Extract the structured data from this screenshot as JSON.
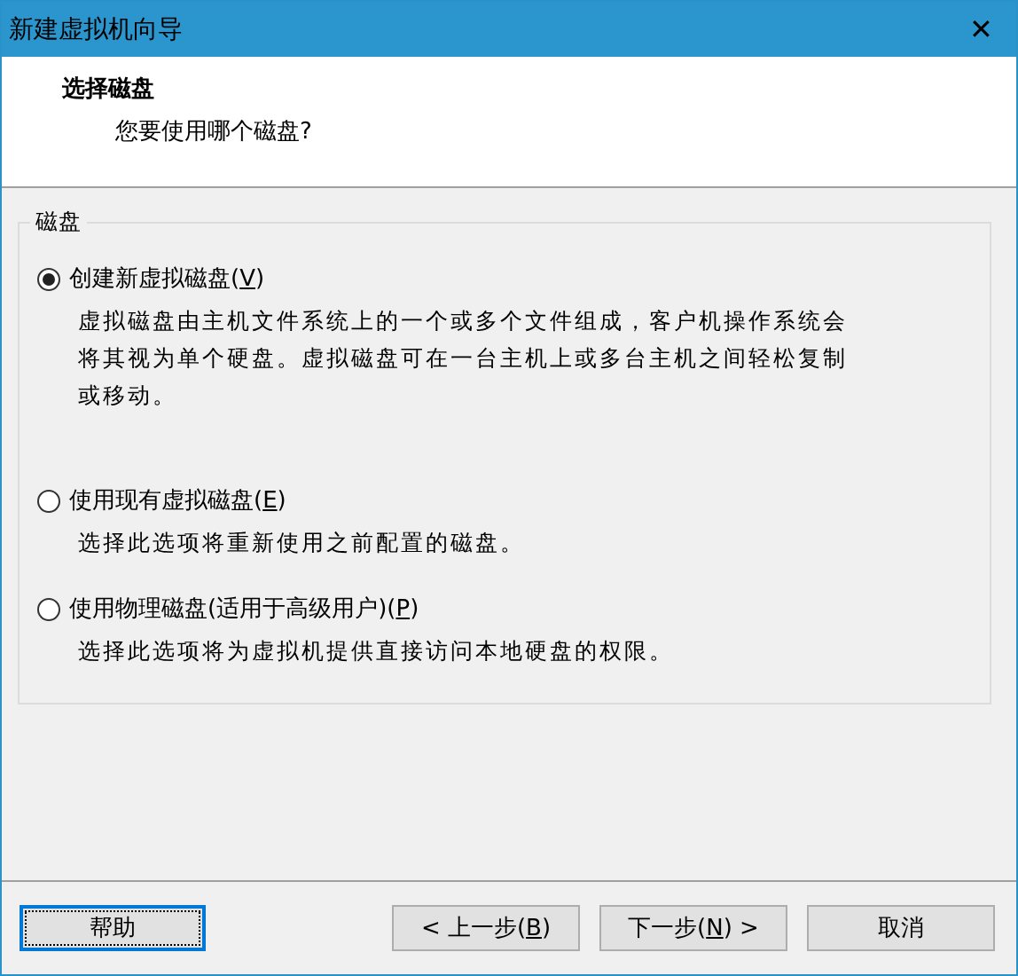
{
  "window": {
    "title": "新建虚拟机向导",
    "close": "✕"
  },
  "header": {
    "title": "选择磁盘",
    "subtitle": "您要使用哪个磁盘?"
  },
  "group": {
    "title": "磁盘",
    "options": [
      {
        "before": "创建新虚拟磁盘(",
        "key": "V",
        "after": ")",
        "description": "虚拟磁盘由主机文件系统上的一个或多个文件组成，客户机操作系统会将其视为单个硬盘。虚拟磁盘可在一台主机上或多台主机之间轻松复制或移动。",
        "selected": true
      },
      {
        "before": "使用现有虚拟磁盘(",
        "key": "E",
        "after": ")",
        "description": "选择此选项将重新使用之前配置的磁盘。",
        "selected": false
      },
      {
        "before": "使用物理磁盘(适用于高级用户)(",
        "key": "P",
        "after": ")",
        "description": "选择此选项将为虚拟机提供直接访问本地硬盘的权限。",
        "selected": false
      }
    ]
  },
  "buttons": [
    {
      "kind": "help",
      "before": "帮助",
      "focused": true
    },
    {
      "kind": "nav",
      "before": "< 上一步(",
      "key": "B",
      "after": ")",
      "focused": false
    },
    {
      "kind": "nav",
      "before": "下一步(",
      "key": "N",
      "after": ") >",
      "focused": false
    },
    {
      "kind": "cancel",
      "before": "取消",
      "focused": false
    }
  ]
}
